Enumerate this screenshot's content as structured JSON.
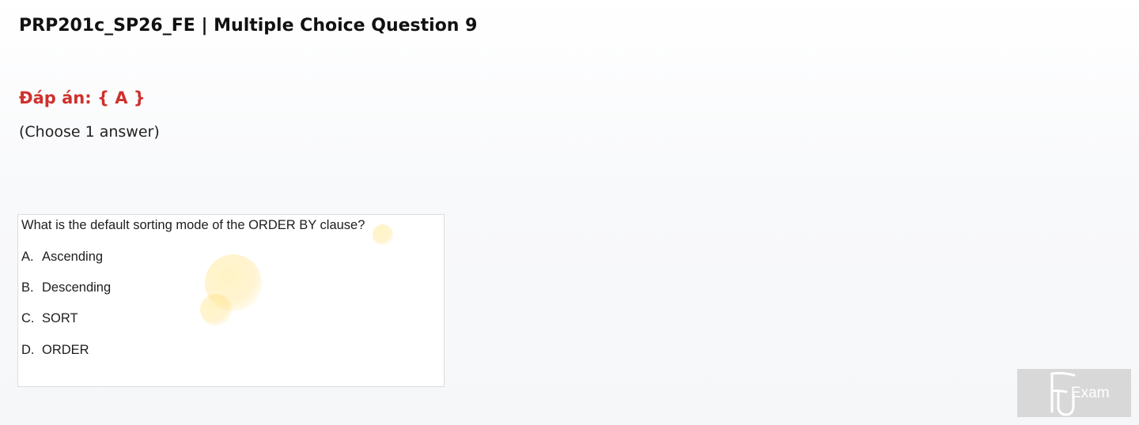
{
  "page": {
    "title": "PRP201c_SP26_FE | Multiple Choice Question 9",
    "answer_label": "Đáp án: { A }",
    "instruction": "(Choose 1 answer)"
  },
  "question": {
    "text": "What is the default sorting mode of the ORDER BY clause?",
    "options": [
      {
        "letter": "A.",
        "text": "Ascending"
      },
      {
        "letter": "B.",
        "text": "Descending"
      },
      {
        "letter": "C.",
        "text": "SORT"
      },
      {
        "letter": "D.",
        "text": "ORDER"
      }
    ]
  },
  "watermark": {
    "text": "Exam",
    "logo_letters": "FU"
  },
  "colors": {
    "answer_red": "#d0302b",
    "title": "#111111",
    "watermark_bg": "#d8d8d8"
  },
  "icons": {
    "watermark_logo": "fu-logo-icon",
    "decor": "smiley-icon"
  }
}
